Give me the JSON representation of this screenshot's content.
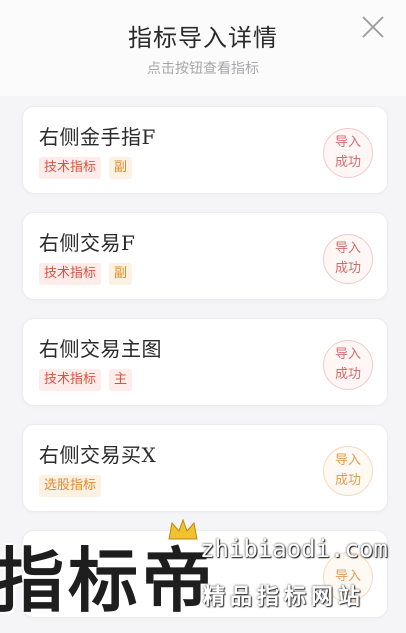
{
  "header": {
    "title": "指标导入详情",
    "subtitle": "点击按钮查看指标",
    "close_icon": "close-icon"
  },
  "colors": {
    "tag_red_text": "#d9533f",
    "tag_red_bg": "#fdecea",
    "tag_orange_text": "#e08a2f",
    "tag_orange_bg": "#fdf1e4",
    "stamp_red": "#d66a6a",
    "stamp_orange": "#e39a52"
  },
  "cards": [
    {
      "name": "右侧金手指F",
      "tags": [
        "技术指标",
        "副"
      ],
      "status": [
        "导入",
        "成功"
      ]
    },
    {
      "name": "右侧交易F",
      "tags": [
        "技术指标",
        "副"
      ],
      "status": [
        "导入",
        "成功"
      ]
    },
    {
      "name": "右侧交易主图",
      "tags": [
        "技术指标",
        "主"
      ],
      "status": [
        "导入",
        "成功"
      ]
    },
    {
      "name": "右侧交易买X",
      "tags": [
        "选股指标"
      ],
      "status": [
        "导入",
        "成功"
      ]
    },
    {
      "name": "",
      "tags": [],
      "status": [
        "导入",
        ""
      ]
    }
  ],
  "watermark": {
    "brand": "指标帝",
    "domain": "zhibiaodi.com",
    "slogan": "精品指标网站"
  }
}
